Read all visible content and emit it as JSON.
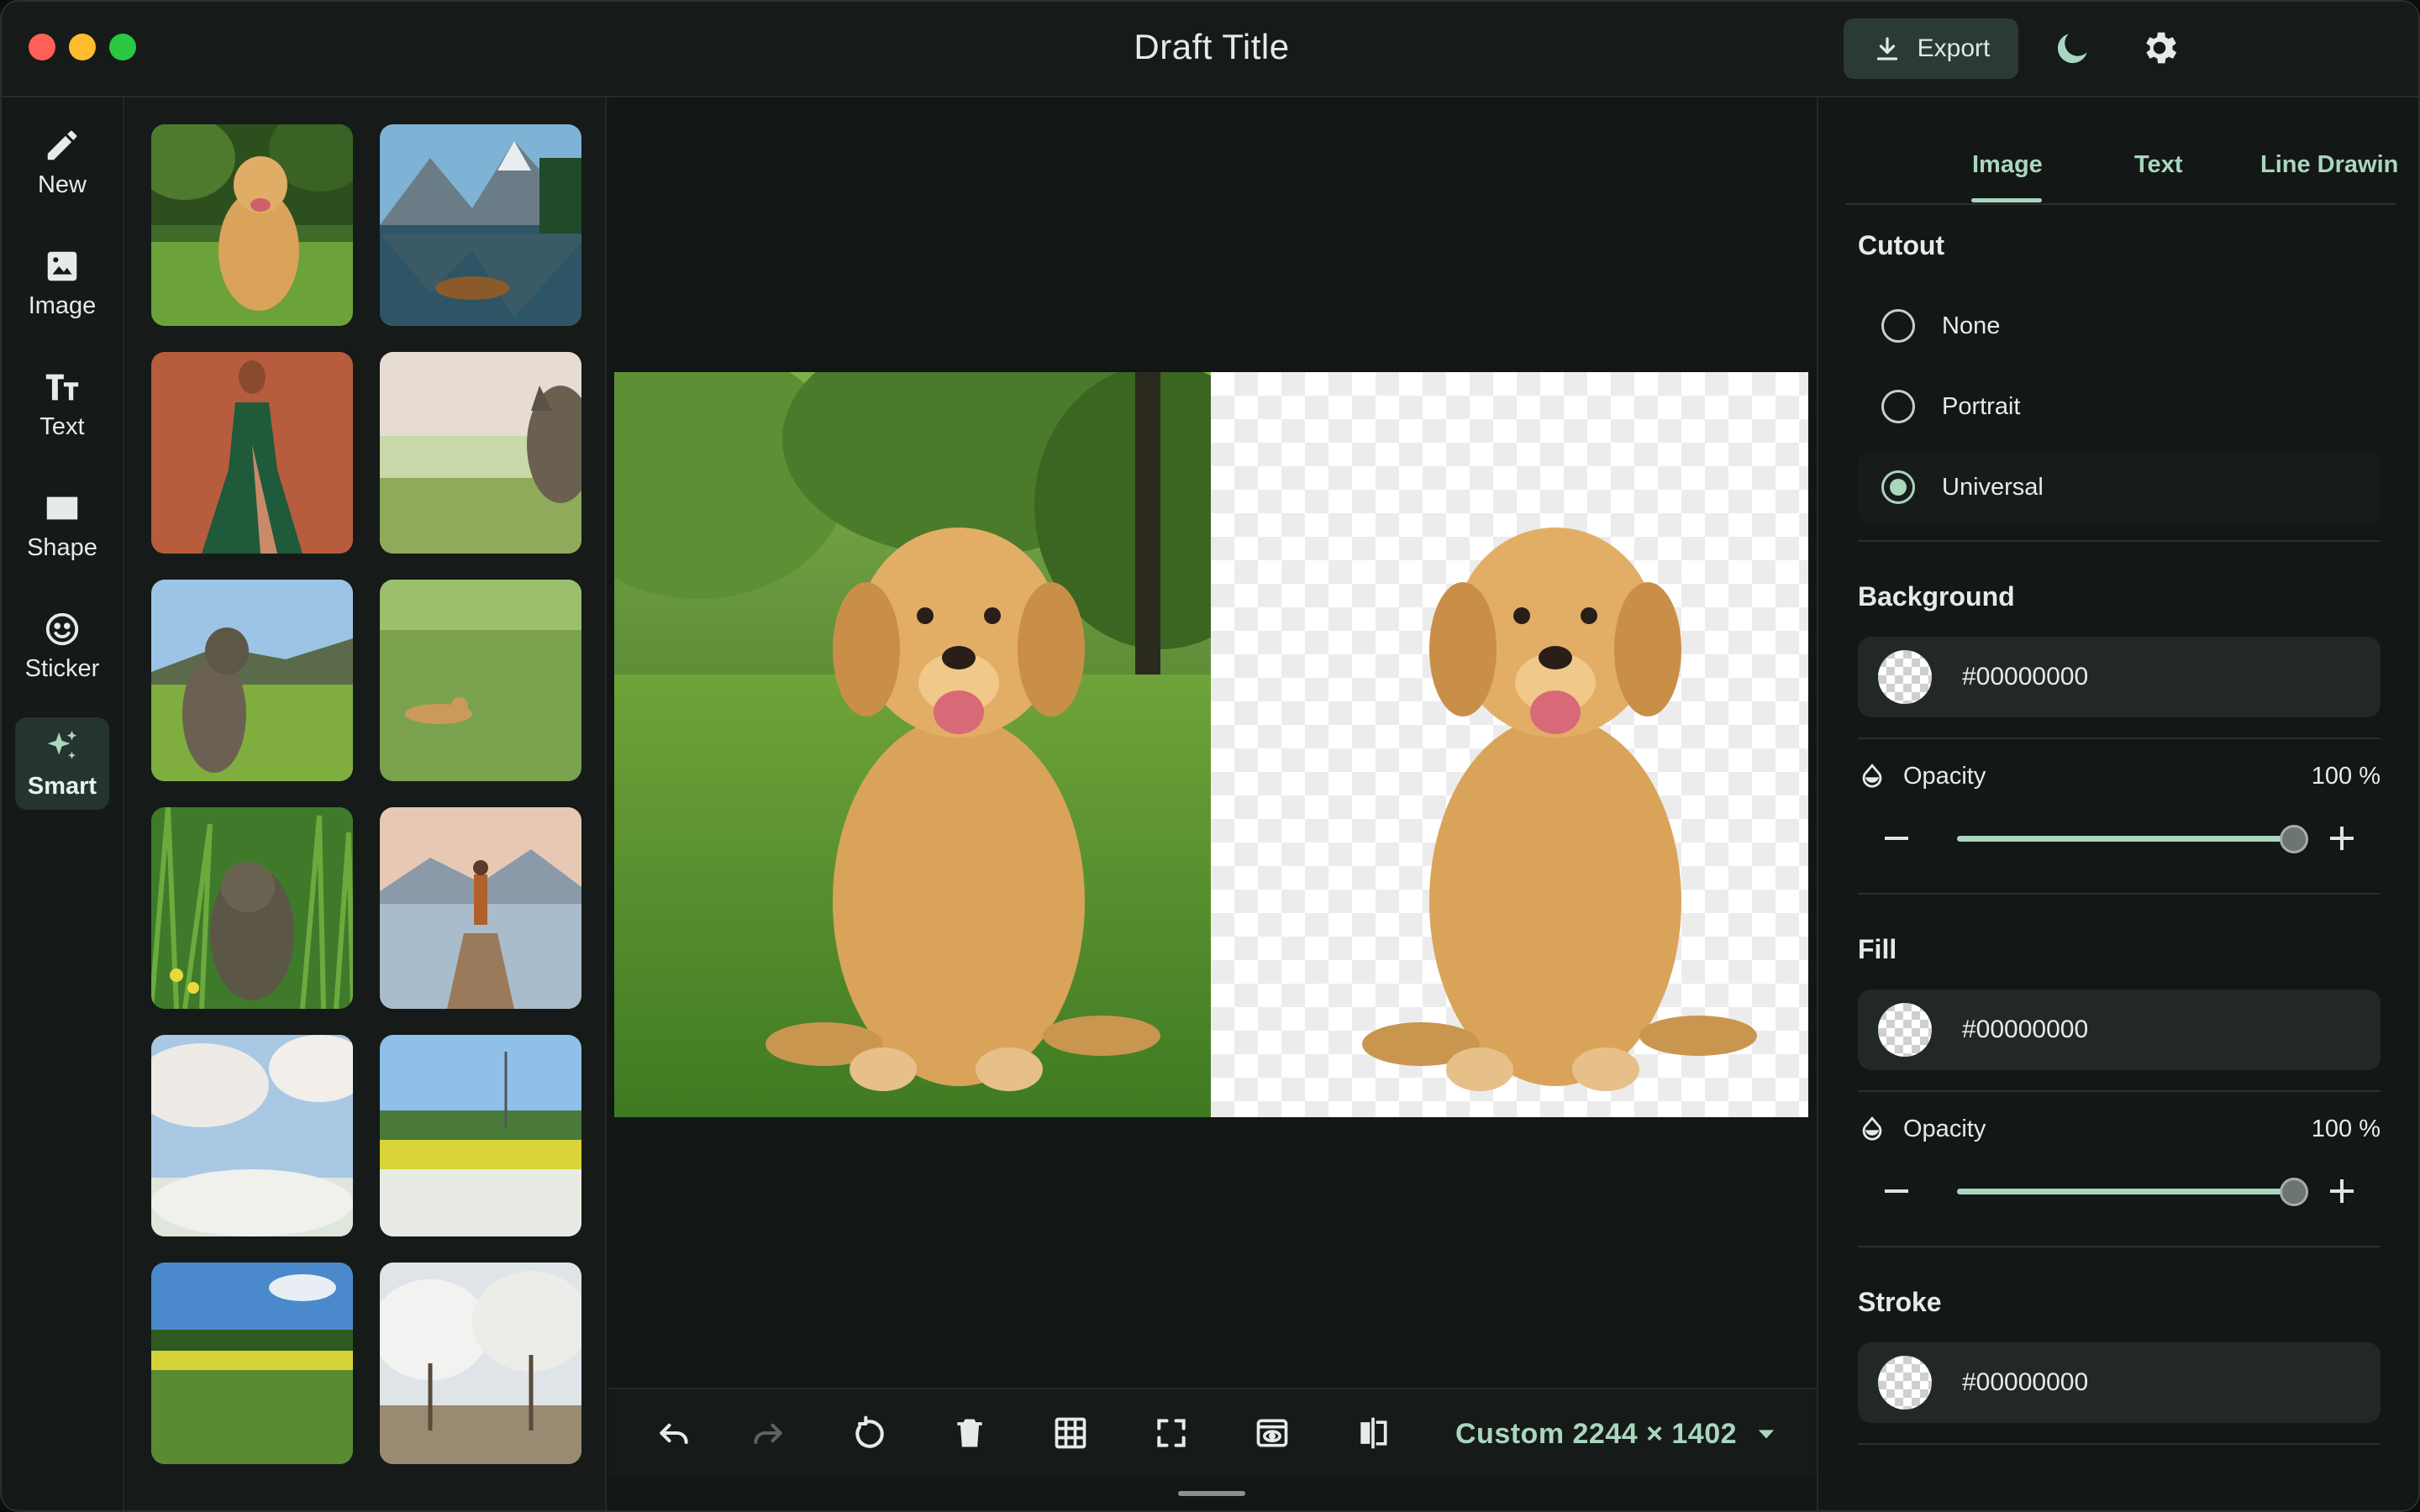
{
  "app": {
    "title": "Draft Title",
    "export_label": "Export"
  },
  "rail": {
    "items": [
      {
        "label": "New",
        "icon": "pencil-icon"
      },
      {
        "label": "Image",
        "icon": "image-icon"
      },
      {
        "label": "Text",
        "icon": "text-icon"
      },
      {
        "label": "Shape",
        "icon": "shape-icon"
      },
      {
        "label": "Sticker",
        "icon": "smiley-icon"
      },
      {
        "label": "Smart",
        "icon": "sparkles-icon",
        "active": true
      }
    ]
  },
  "thumbnails": [
    "golden retriever on grass",
    "mountain lake with boat",
    "woman in green dress",
    "cat profile on meadow",
    "cat on hillside",
    "cat lying in field",
    "cat in tall grass",
    "person on lake dock",
    "cherry blossoms and sky",
    "flower field with pylon",
    "green field under sky",
    "blossoming trees path"
  ],
  "toolbar": {
    "icons": [
      "undo-icon",
      "redo-icon",
      "rotate-icon",
      "trash-icon",
      "grid-icon",
      "fit-screen-icon",
      "preview-icon",
      "compare-icon"
    ],
    "canvas_size": "Custom 2244 × 1402"
  },
  "panel": {
    "tabs": [
      "Image",
      "Text",
      "Line Drawin"
    ],
    "active_tab": "Image",
    "cutout": {
      "title": "Cutout",
      "options": [
        "None",
        "Portrait",
        "Universal"
      ],
      "selected": "Universal"
    },
    "background": {
      "title": "Background",
      "color": "#00000000",
      "opacity_label": "Opacity",
      "opacity_value": "100 %",
      "opacity": 1.0
    },
    "fill": {
      "title": "Fill",
      "color": "#00000000",
      "opacity_label": "Opacity",
      "opacity_value": "100 %",
      "opacity": 1.0
    },
    "stroke": {
      "title": "Stroke",
      "color": "#00000000"
    }
  },
  "colors": {
    "accent": "#a9d6bd",
    "active_bg": "#263430",
    "export_bg": "#2c3a35"
  }
}
